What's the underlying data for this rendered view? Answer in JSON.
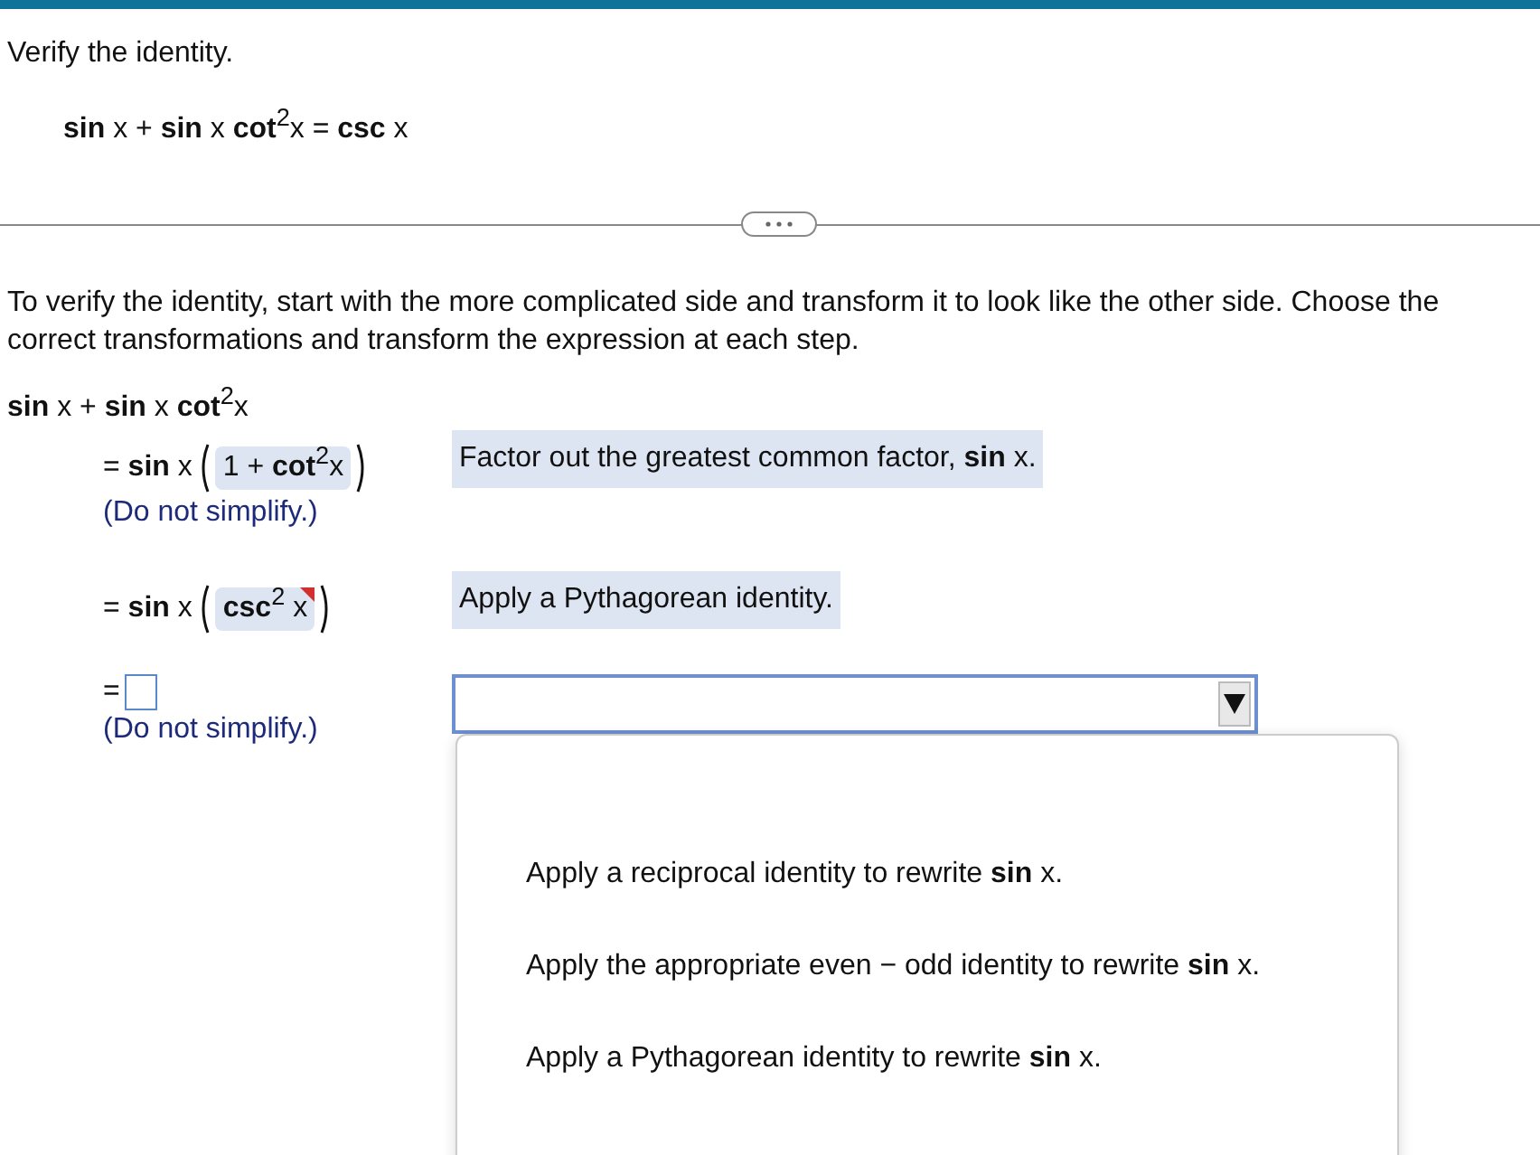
{
  "title": "Verify the identity.",
  "identity": "**sin** x + **sin** x **cot**$^{2}$x = **csc** x",
  "instructions": "To verify the identity, start with the more complicated side and transform it to look like the other side. Choose the correct transformations and transform the expression at each step.",
  "start_expression": "**sin** x + **sin** x **cot**$^{2}$x",
  "steps": [
    {
      "kind": "answered",
      "prefix": "= **sin** x",
      "answer": "1 + **cot**$^{2}$x",
      "flagged": false,
      "note": "(Do not simplify.)",
      "reason": "Factor out the greatest common factor, **sin** x."
    },
    {
      "kind": "answered",
      "prefix": "= **sin** x",
      "answer": "**csc**$^{2}$ x",
      "flagged": true,
      "reason": "Apply a Pythagorean identity."
    },
    {
      "kind": "blank",
      "prefix": "=",
      "note": "(Do not simplify.)",
      "dropdown": {
        "expanded": true,
        "options": [
          {
            "label": "Apply a reciprocal identity to rewrite **sin** x.",
            "selected": false
          },
          {
            "label": "Apply the appropriate even − odd identity to rewrite **sin** x.",
            "selected": false
          },
          {
            "label": "Apply a Pythagorean identity to rewrite **sin** x.",
            "selected": false
          }
        ]
      }
    }
  ]
}
